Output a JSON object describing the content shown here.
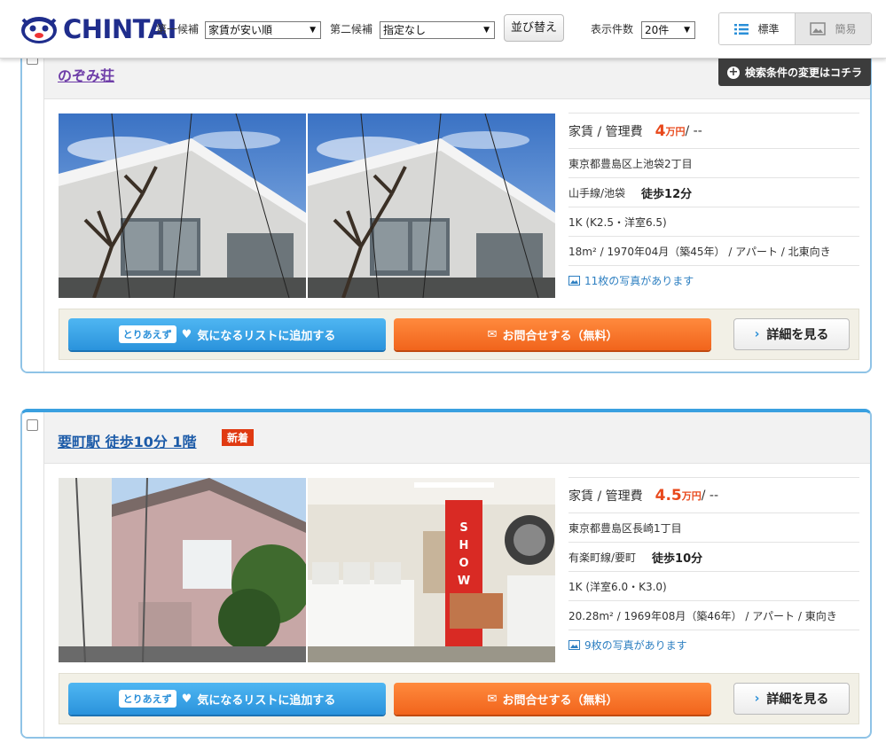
{
  "header": {
    "logo_text": "CHINTAI",
    "first_label": "第一候補",
    "first_value": "家賃が安い順",
    "second_label": "第二候補",
    "second_value": "指定なし",
    "sort_button": "並び替え",
    "count_label": "表示件数",
    "count_value": "20件",
    "view_standard": "標準",
    "view_simple": "簡易"
  },
  "change_conditions": "検索条件の変更はコチラ",
  "listings": [
    {
      "title": "のぞみ荘",
      "badge": "",
      "rent_label": "家賃 / 管理費",
      "rent_value": "4",
      "rent_unit": "万円",
      "fee": " / --",
      "address": "東京都豊島区上池袋2丁目",
      "line": "山手線/池袋",
      "walk": "徒歩12分",
      "layout": "1K (K2.5・洋室6.5)",
      "detail": "18m² / 1970年04月（築45年） / アパート / 北東向き",
      "photos": "11枚の写真があります"
    },
    {
      "title": "要町駅 徒歩10分 1階",
      "badge": "新着",
      "rent_label": "家賃 / 管理費",
      "rent_value": "4.5",
      "rent_unit": "万円",
      "fee": " / --",
      "address": "東京都豊島区長崎1丁目",
      "line": "有楽町線/要町",
      "walk": "徒歩10分",
      "layout": "1K (洋室6.0・K3.0)",
      "detail": "20.28m² / 1969年08月（築46年） / アパート / 東向き",
      "photos": "9枚の写真があります"
    }
  ],
  "actions": {
    "toriaezu": "とりあえず",
    "favorite": "気になるリストに追加する",
    "inquiry": "お問合せする（無料）",
    "details": "詳細を見る"
  }
}
